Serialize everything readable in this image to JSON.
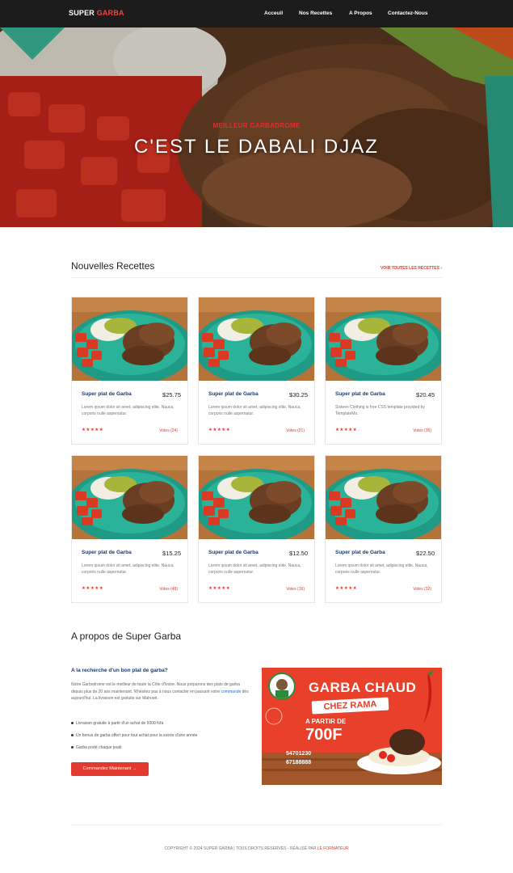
{
  "header": {
    "brand_part1": "SUPER ",
    "brand_part2": "GARBA",
    "nav": [
      "Acceuil",
      "Nos Recettes",
      "A Propos",
      "Contactez-Nous"
    ]
  },
  "hero": {
    "kicker": "MEILLEUR GARBADROME",
    "title": "C'EST LE DABALI DJAZ"
  },
  "recipes": {
    "title": "Nouvelles Recettes",
    "see_all": "VOIR TOUTES LES RECETTES ›",
    "cards": [
      {
        "name": "Super plat de Garba",
        "price": "$25.75",
        "desc": "Lorem ipsum dolor sit amet, adipiscing elite. Nauca, corporis nulle aspernatur.",
        "stars": "★★★★★",
        "votes": "Votes (24)"
      },
      {
        "name": "Super plat de Garba",
        "price": "$30.25",
        "desc": "Lorem ipsum dolor sit amet, adipiscing elite. Nauca, corporis nulle aspernatur.",
        "stars": "★★★★★",
        "votes": "Votes (21)"
      },
      {
        "name": "Super plat de Garba",
        "price": "$20.45",
        "desc": "Sixteen Clothing is free CSS template provided by TemplateMo.",
        "stars": "★★★★★",
        "votes": "Votes (36)"
      },
      {
        "name": "Super plat de Garba",
        "price": "$15.25",
        "desc": "Lorem ipsum dolor sit amet, adipiscing elite. Nauca, corporis nulle aspernatur.",
        "stars": "★★★★★",
        "votes": "Votes (48)"
      },
      {
        "name": "Super plat de Garba",
        "price": "$12.50",
        "desc": "Lorem ipsum dolor sit amet, adipiscing elite. Nauca, corporis nulle aspernatur.",
        "stars": "★★★★★",
        "votes": "Votes (16)"
      },
      {
        "name": "Super plat de Garba",
        "price": "$22.50",
        "desc": "Lorem ipsum dolor sit amet, adipiscing elite. Nauca, corporis nulle aspernatur.",
        "stars": "★★★★★",
        "votes": "Votes (32)"
      }
    ]
  },
  "about": {
    "title": "A propos de Super Garba",
    "question": "A la recherche d'un bon plat de garba?",
    "text_before": "Notre Garbodrome est le meilleur de toute la Côte d'Ivoire. Nous préparons des plats de garba depuis plus de 20 ans maintenant. N'hésitez pas à nous contacter en passant votre ",
    "text_link": "commande",
    "text_after": " dès aujourd'hui. La livraison est gratuite sur Mahoué.",
    "bullets": [
      "Livraison gratuite à partir d'un achat de 5000 fcfa",
      "Un bonus de garba offert pour tout achat pour la soirée d'une année",
      "Garba porté chaque jeudi"
    ],
    "cta": "Commandez Maintenant →"
  },
  "promo": {
    "line1": "GARBA CHAUD",
    "line2": "CHEZ RAMA",
    "line3": "A PARTIR DE",
    "price": "700F",
    "phone1": "54701230",
    "phone2": "67188888"
  },
  "footer": {
    "text": "COPYRIGHT © 2024 SUPER GARBA | TOUS DROITS RÉSERVÉS - RÉALISÉ PAR ",
    "author": "LE FORMATEUR"
  },
  "colors": {
    "accent": "#e23a2e",
    "navbar": "#1c1c1c",
    "title_blue": "#1f3a6b"
  }
}
